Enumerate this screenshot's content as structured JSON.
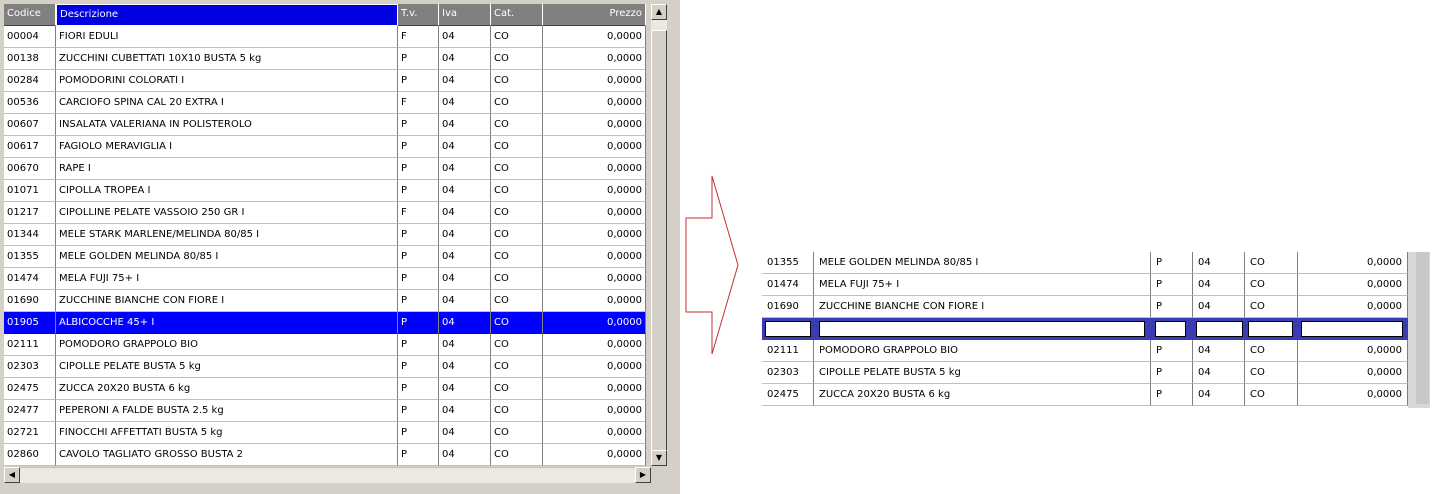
{
  "grid": {
    "columns": [
      "Codice",
      "Descrizione",
      "T.v.",
      "Iva",
      "Cat.",
      "Prezzo"
    ],
    "focused_column": 1,
    "selected_index": 13,
    "selected_color": "#0000ff",
    "rows": [
      {
        "codice": "00004",
        "descrizione": "FIORI EDULI",
        "tv": "F",
        "iva": "04",
        "cat": "CO",
        "prezzo": "0,0000"
      },
      {
        "codice": "00138",
        "descrizione": "ZUCCHINI CUBETTATI 10X10 BUSTA 5 kg",
        "tv": "P",
        "iva": "04",
        "cat": "CO",
        "prezzo": "0,0000"
      },
      {
        "codice": "00284",
        "descrizione": "POMODORINI COLORATI  I",
        "tv": "P",
        "iva": "04",
        "cat": "CO",
        "prezzo": "0,0000"
      },
      {
        "codice": "00536",
        "descrizione": "CARCIOFO SPINA CAL 20 EXTRA  I",
        "tv": "F",
        "iva": "04",
        "cat": "CO",
        "prezzo": "0,0000"
      },
      {
        "codice": "00607",
        "descrizione": "INSALATA VALERIANA IN POLISTEROLO",
        "tv": "P",
        "iva": "04",
        "cat": "CO",
        "prezzo": "0,0000"
      },
      {
        "codice": "00617",
        "descrizione": "FAGIOLO MERAVIGLIA I",
        "tv": "P",
        "iva": "04",
        "cat": "CO",
        "prezzo": "0,0000"
      },
      {
        "codice": "00670",
        "descrizione": "RAPE  I",
        "tv": "P",
        "iva": "04",
        "cat": "CO",
        "prezzo": "0,0000"
      },
      {
        "codice": "01071",
        "descrizione": "CIPOLLA TROPEA  I",
        "tv": "P",
        "iva": "04",
        "cat": "CO",
        "prezzo": "0,0000"
      },
      {
        "codice": "01217",
        "descrizione": "CIPOLLINE PELATE VASSOIO 250 GR  I",
        "tv": "F",
        "iva": "04",
        "cat": "CO",
        "prezzo": "0,0000"
      },
      {
        "codice": "01344",
        "descrizione": "MELE STARK MARLENE/MELINDA 80/85 I",
        "tv": "P",
        "iva": "04",
        "cat": "CO",
        "prezzo": "0,0000"
      },
      {
        "codice": "01355",
        "descrizione": "MELE GOLDEN MELINDA 80/85  I",
        "tv": "P",
        "iva": "04",
        "cat": "CO",
        "prezzo": "0,0000"
      },
      {
        "codice": "01474",
        "descrizione": "MELA FUJI 75+ I",
        "tv": "P",
        "iva": "04",
        "cat": "CO",
        "prezzo": "0,0000"
      },
      {
        "codice": "01690",
        "descrizione": "ZUCCHINE BIANCHE CON FIORE  I",
        "tv": "P",
        "iva": "04",
        "cat": "CO",
        "prezzo": "0,0000"
      },
      {
        "codice": "01905",
        "descrizione": "ALBICOCCHE 45+ I",
        "tv": "P",
        "iva": "04",
        "cat": "CO",
        "prezzo": "0,0000"
      },
      {
        "codice": "02111",
        "descrizione": "POMODORO GRAPPOLO BIO",
        "tv": "P",
        "iva": "04",
        "cat": "CO",
        "prezzo": "0,0000"
      },
      {
        "codice": "02303",
        "descrizione": "CIPOLLE PELATE BUSTA 5 kg",
        "tv": "P",
        "iva": "04",
        "cat": "CO",
        "prezzo": "0,0000"
      },
      {
        "codice": "02475",
        "descrizione": "ZUCCA 20X20 BUSTA 6 kg",
        "tv": "P",
        "iva": "04",
        "cat": "CO",
        "prezzo": "0,0000"
      },
      {
        "codice": "02477",
        "descrizione": "PEPERONI A FALDE BUSTA 2.5 kg",
        "tv": "P",
        "iva": "04",
        "cat": "CO",
        "prezzo": "0,0000"
      },
      {
        "codice": "02721",
        "descrizione": "FINOCCHI AFFETTATI BUSTA 5 kg",
        "tv": "P",
        "iva": "04",
        "cat": "CO",
        "prezzo": "0,0000"
      },
      {
        "codice": "02860",
        "descrizione": "CAVOLO TAGLIATO GROSSO BUSTA 2",
        "tv": "P",
        "iva": "04",
        "cat": "CO",
        "prezzo": "0,0000"
      }
    ]
  },
  "scrollbar_icons": {
    "up": "arrow-up-icon",
    "down": "arrow-down-icon",
    "left": "arrow-left-icon",
    "right": "arrow-right-icon"
  },
  "scrollbar_glyphs": {
    "up": "▲",
    "down": "▼",
    "left": "◀",
    "right": "▶"
  },
  "zoom": {
    "rows_above": [
      {
        "codice": "01355",
        "descrizione": "MELE GOLDEN MELINDA 80/85  I",
        "tv": "P",
        "iva": "04",
        "cat": "CO",
        "prezzo": "0,0000"
      },
      {
        "codice": "01474",
        "descrizione": "MELA FUJI 75+ I",
        "tv": "P",
        "iva": "04",
        "cat": "CO",
        "prezzo": "0,0000"
      },
      {
        "codice": "01690",
        "descrizione": "ZUCCHINE BIANCHE CON FIORE  I",
        "tv": "P",
        "iva": "04",
        "cat": "CO",
        "prezzo": "0,0000"
      }
    ],
    "rows_below": [
      {
        "codice": "02111",
        "descrizione": "POMODORO GRAPPOLO BIO",
        "tv": "P",
        "iva": "04",
        "cat": "CO",
        "prezzo": "0,0000"
      },
      {
        "codice": "02303",
        "descrizione": "CIPOLLE PELATE BUSTA 5 kg",
        "tv": "P",
        "iva": "04",
        "cat": "CO",
        "prezzo": "0,0000"
      },
      {
        "codice": "02475",
        "descrizione": "ZUCCA 20X20 BUSTA 6 kg",
        "tv": "P",
        "iva": "04",
        "cat": "CO",
        "prezzo": "0,0000"
      }
    ],
    "edit_row_color": "#3b3bb4"
  },
  "arrow_color": "#c03030"
}
